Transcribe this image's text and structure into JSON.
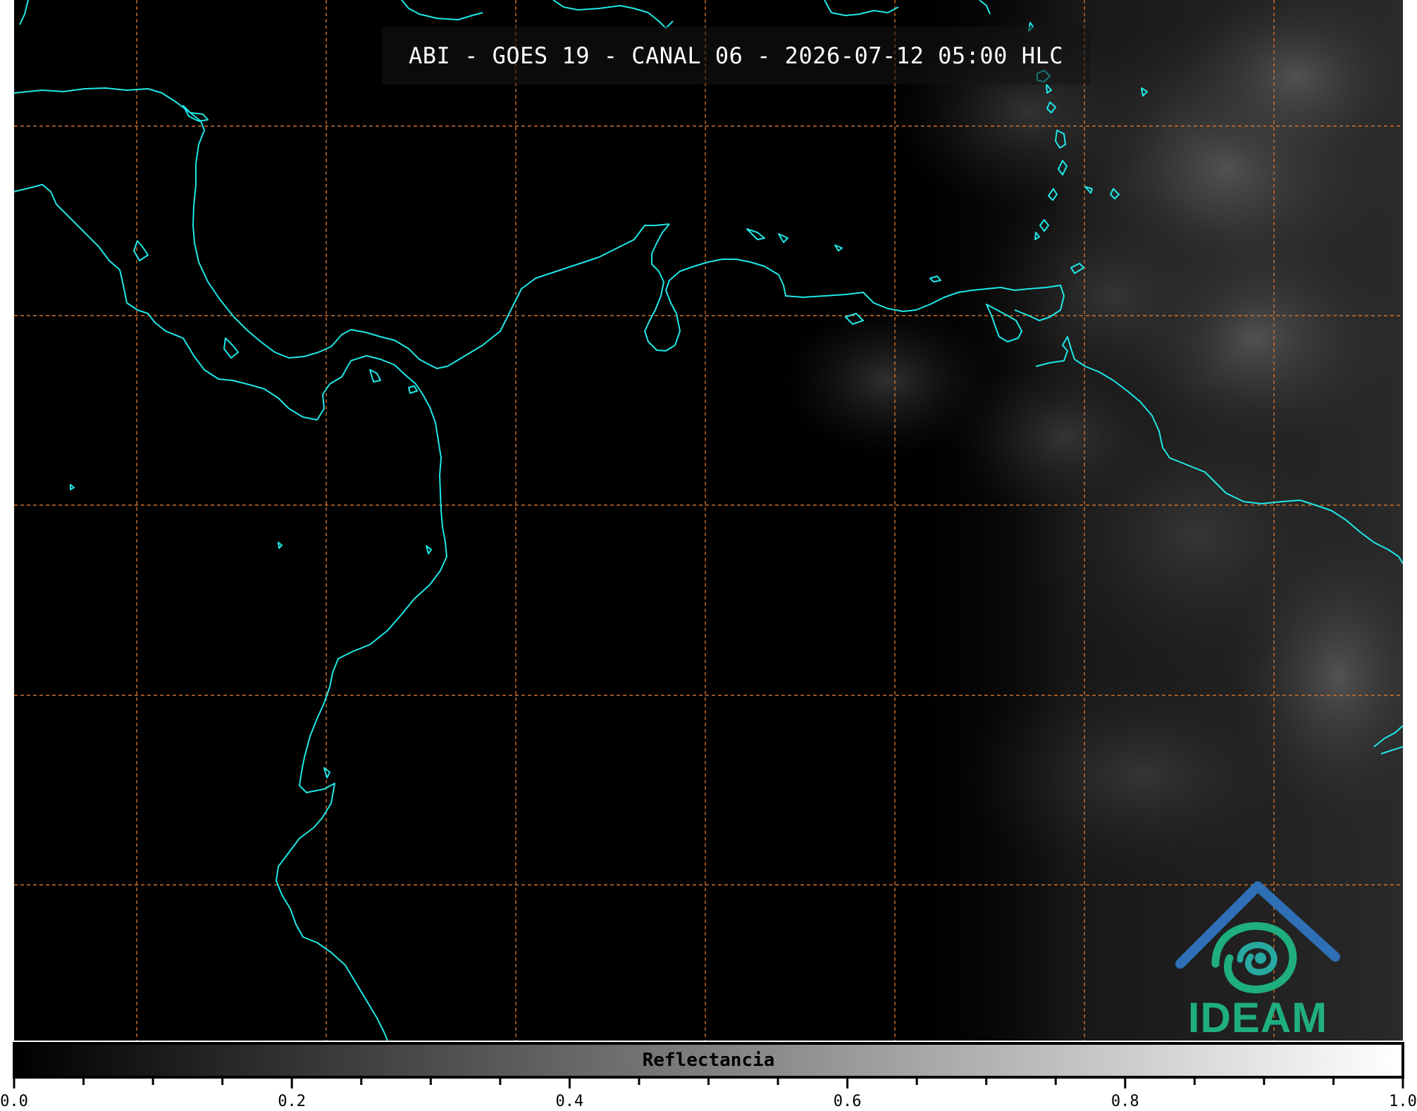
{
  "title": "ABI - GOES 19 - CANAL 06 - 2026-07-12 05:00 HLC",
  "colors": {
    "coastline": "#1fe8e8",
    "graticule": "#d0712a",
    "logo_blue": "#2f6fb5",
    "logo_green": "#1fae7f"
  },
  "icons": [
    "ideam-logo-icon"
  ],
  "logo": {
    "text": "IDEAM"
  },
  "colorbar": {
    "label": "Reflectancia",
    "range": [
      0.0,
      1.0
    ],
    "ticks": [
      "0.0",
      "0.2",
      "0.4",
      "0.6",
      "0.8",
      "1.0"
    ]
  }
}
